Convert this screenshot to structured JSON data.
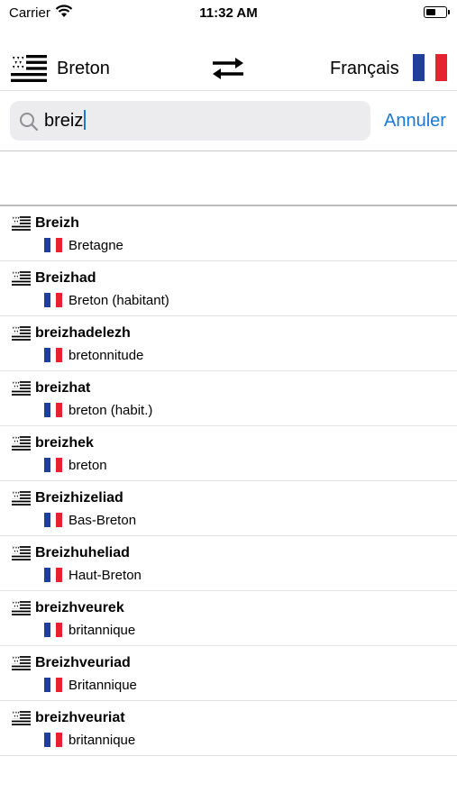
{
  "status": {
    "carrier": "Carrier",
    "time": "11:32 AM"
  },
  "header": {
    "from_lang": "Breton",
    "to_lang": "Français"
  },
  "search": {
    "query": "breiz",
    "cancel_label": "Annuler"
  },
  "colors": {
    "accent": "#1a78d6",
    "fr_blue": "#1f3f9a",
    "fr_red": "#e6222e"
  },
  "results": [
    {
      "term": "Breizh",
      "translation": "Bretagne"
    },
    {
      "term": "Breizhad",
      "translation": "Breton (habitant)"
    },
    {
      "term": "breizhadelezh",
      "translation": "bretonnitude"
    },
    {
      "term": "breizhat",
      "translation": "breton (habit.)"
    },
    {
      "term": "breizhek",
      "translation": "breton"
    },
    {
      "term": "Breizhizeliad",
      "translation": "Bas-Breton"
    },
    {
      "term": "Breizhuheliad",
      "translation": "Haut-Breton"
    },
    {
      "term": "breizhveurek",
      "translation": "britannique"
    },
    {
      "term": "Breizhveuriad",
      "translation": "Britannique"
    },
    {
      "term": "breizhveuriat",
      "translation": "britannique"
    }
  ]
}
